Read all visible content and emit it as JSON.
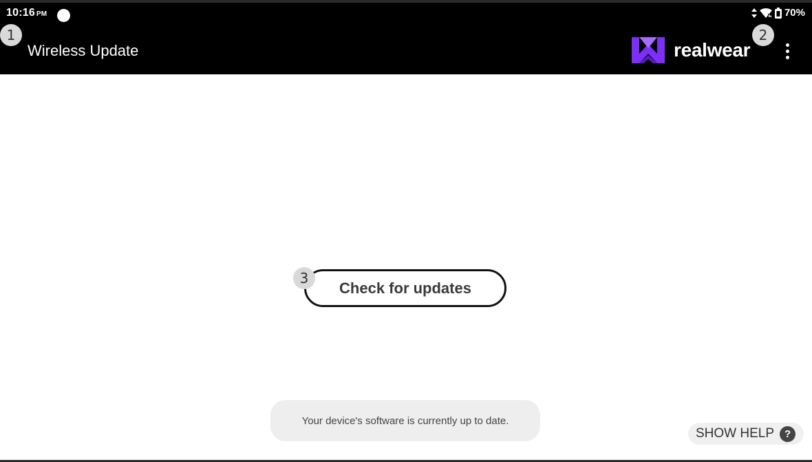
{
  "status_bar": {
    "time": "10:16",
    "ampm": "PM",
    "battery": "70%"
  },
  "app_bar": {
    "title": "Wireless Update",
    "logo_text": "realwear",
    "logo_color": "#7b2ff7"
  },
  "markers": [
    "1",
    "2",
    "3"
  ],
  "main": {
    "check_button_label": "Check for updates"
  },
  "toast": {
    "message": "Your device's software is currently up to date."
  },
  "help": {
    "label": "SHOW HELP",
    "icon_glyph": "?"
  },
  "icons": [
    "data-arrows-icon",
    "wifi-icon",
    "battery-icon",
    "overflow-menu-icon",
    "help-icon",
    "realwear-logo-icon"
  ]
}
